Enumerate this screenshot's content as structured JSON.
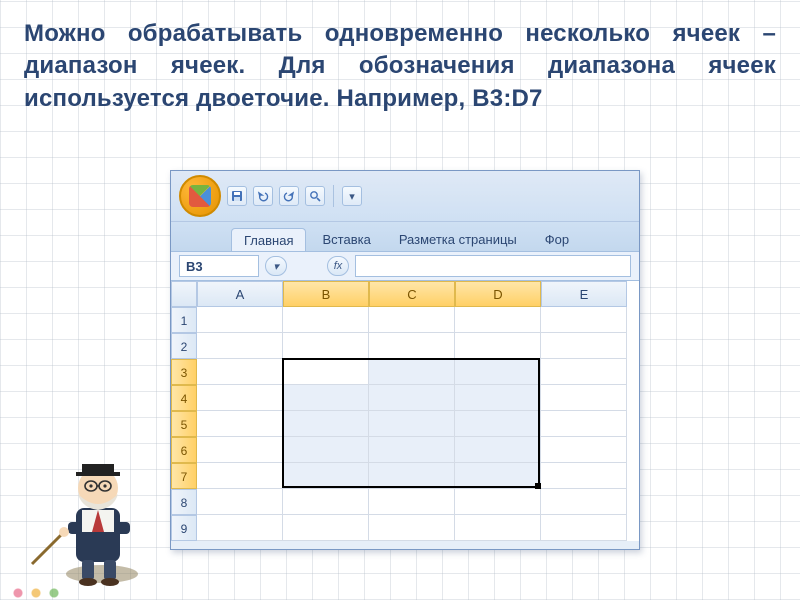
{
  "slide": {
    "text": "Можно обрабатывать одновременно несколько ячеек – диапазон ячеек. Для обозначения диапазона ячеек используется двоеточие. Например, ",
    "example": "B3:D7"
  },
  "excel": {
    "qat": {
      "save_icon": "save-icon",
      "undo_icon": "undo-icon",
      "redo_icon": "redo-icon",
      "print_icon": "print-icon"
    },
    "tabs": {
      "home": "Главная",
      "insert": "Вставка",
      "page_layout": "Разметка страницы",
      "formulas": "Фор"
    },
    "name_box": "B3",
    "fx_label": "fx",
    "columns": [
      "A",
      "B",
      "C",
      "D",
      "E"
    ],
    "rows": [
      "1",
      "2",
      "3",
      "4",
      "5",
      "6",
      "7",
      "8",
      "9"
    ],
    "selection": {
      "active_cell": "B3",
      "range": "B3:D7",
      "col_start": 1,
      "col_end": 3,
      "row_start": 2,
      "row_end": 6
    }
  }
}
